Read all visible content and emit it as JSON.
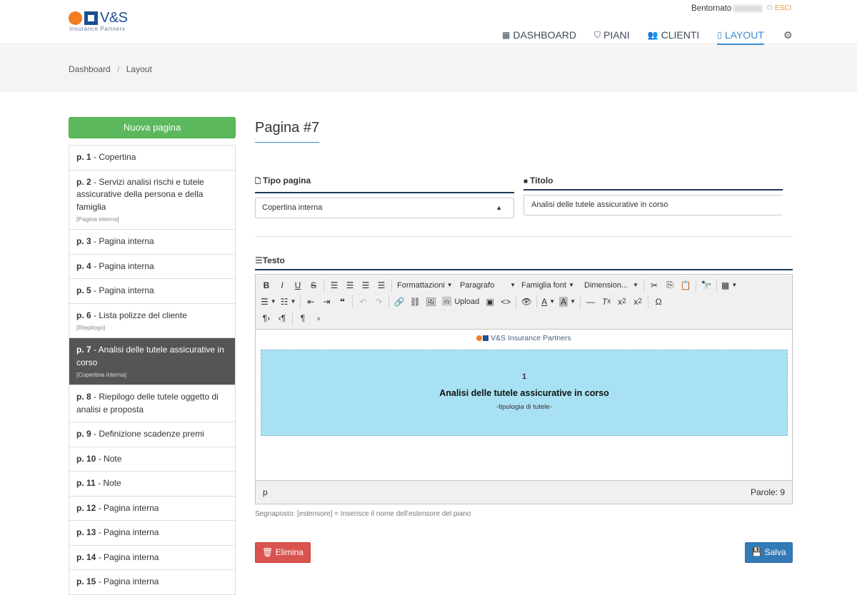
{
  "brand": {
    "name": "V&S",
    "tagline": "Insurance Partners"
  },
  "user": {
    "greeting": "Bentornato",
    "logout": "ESCI"
  },
  "nav": {
    "dashboard": "DASHBOARD",
    "piani": "PIANI",
    "clienti": "CLIENTI",
    "layout": "LAYOUT"
  },
  "breadcrumb": {
    "home": "Dashboard",
    "sep": "/",
    "current": "Layout"
  },
  "sidebar": {
    "new_page": "Nuova pagina",
    "items": [
      {
        "num": "p. 1",
        "title": " - Copertina",
        "tag": ""
      },
      {
        "num": "p. 2",
        "title": " - Servizi analisi rischi e tutele assicurative della persona e della famiglia",
        "tag": "[Pagina interna]"
      },
      {
        "num": "p. 3",
        "title": " - Pagina interna",
        "tag": ""
      },
      {
        "num": "p. 4",
        "title": " - Pagina interna",
        "tag": ""
      },
      {
        "num": "p. 5",
        "title": " - Pagina interna",
        "tag": ""
      },
      {
        "num": "p. 6",
        "title": " - Lista polizze del cliente",
        "tag": "[Riepilogo]"
      },
      {
        "num": "p. 7",
        "title": " - Analisi delle tutele assicurative in corso",
        "tag": "[Copertina interna]"
      },
      {
        "num": "p. 8",
        "title": " - Riepilogo delle tutele oggetto di analisi e proposta",
        "tag": ""
      },
      {
        "num": "p. 9",
        "title": " - Definizione scadenze premi",
        "tag": ""
      },
      {
        "num": "p. 10",
        "title": " - Note",
        "tag": ""
      },
      {
        "num": "p. 11",
        "title": " - Note",
        "tag": ""
      },
      {
        "num": "p. 12",
        "title": " - Pagina interna",
        "tag": ""
      },
      {
        "num": "p. 13",
        "title": " - Pagina interna",
        "tag": ""
      },
      {
        "num": "p. 14",
        "title": " - Pagina interna",
        "tag": ""
      },
      {
        "num": "p. 15",
        "title": " - Pagina interna",
        "tag": ""
      }
    ]
  },
  "main": {
    "title": "Pagina #7",
    "tipo_label": "Tipo pagina",
    "tipo_value": "Copertina interna",
    "titolo_label": "Titolo",
    "titolo_value": "Analisi delle tutele assicurative in corso",
    "testo_label": "Testo",
    "toolbar": {
      "formattazioni": "Formattazioni",
      "paragrafo": "Paragrafo",
      "famiglia": "Famiglia font",
      "dimensione": "Dimension...",
      "upload": "Upload"
    },
    "content": {
      "logo_text": "V&S Insurance Partners",
      "number": "1",
      "heading": "Analisi delle tutele assicurative in corso",
      "subheading": "-tipologia di tutele-"
    },
    "status_path": "p",
    "word_count": "Parole: 9",
    "hint": "Segnaposto: [estensore] = Inserisce il nome dell'estensore del piano"
  },
  "actions": {
    "delete": "Elimina",
    "save": "Salva"
  },
  "colors": {
    "accent": "#3b8bd0",
    "success": "#5cb85c",
    "danger": "#d9534f",
    "primary": "#337ab7",
    "banner": "#a9e1f4"
  }
}
